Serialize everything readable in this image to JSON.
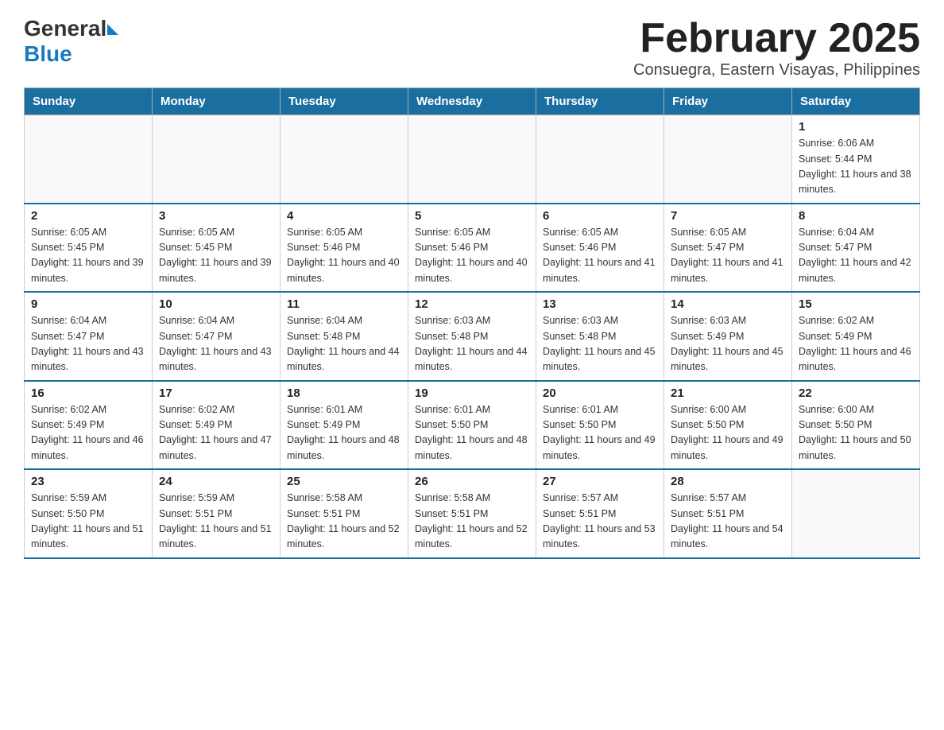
{
  "header": {
    "logo_general": "General",
    "logo_blue": "Blue",
    "month_title": "February 2025",
    "location": "Consuegra, Eastern Visayas, Philippines"
  },
  "weekdays": [
    "Sunday",
    "Monday",
    "Tuesday",
    "Wednesday",
    "Thursday",
    "Friday",
    "Saturday"
  ],
  "weeks": [
    [
      {
        "day": "",
        "info": ""
      },
      {
        "day": "",
        "info": ""
      },
      {
        "day": "",
        "info": ""
      },
      {
        "day": "",
        "info": ""
      },
      {
        "day": "",
        "info": ""
      },
      {
        "day": "",
        "info": ""
      },
      {
        "day": "1",
        "info": "Sunrise: 6:06 AM\nSunset: 5:44 PM\nDaylight: 11 hours and 38 minutes."
      }
    ],
    [
      {
        "day": "2",
        "info": "Sunrise: 6:05 AM\nSunset: 5:45 PM\nDaylight: 11 hours and 39 minutes."
      },
      {
        "day": "3",
        "info": "Sunrise: 6:05 AM\nSunset: 5:45 PM\nDaylight: 11 hours and 39 minutes."
      },
      {
        "day": "4",
        "info": "Sunrise: 6:05 AM\nSunset: 5:46 PM\nDaylight: 11 hours and 40 minutes."
      },
      {
        "day": "5",
        "info": "Sunrise: 6:05 AM\nSunset: 5:46 PM\nDaylight: 11 hours and 40 minutes."
      },
      {
        "day": "6",
        "info": "Sunrise: 6:05 AM\nSunset: 5:46 PM\nDaylight: 11 hours and 41 minutes."
      },
      {
        "day": "7",
        "info": "Sunrise: 6:05 AM\nSunset: 5:47 PM\nDaylight: 11 hours and 41 minutes."
      },
      {
        "day": "8",
        "info": "Sunrise: 6:04 AM\nSunset: 5:47 PM\nDaylight: 11 hours and 42 minutes."
      }
    ],
    [
      {
        "day": "9",
        "info": "Sunrise: 6:04 AM\nSunset: 5:47 PM\nDaylight: 11 hours and 43 minutes."
      },
      {
        "day": "10",
        "info": "Sunrise: 6:04 AM\nSunset: 5:47 PM\nDaylight: 11 hours and 43 minutes."
      },
      {
        "day": "11",
        "info": "Sunrise: 6:04 AM\nSunset: 5:48 PM\nDaylight: 11 hours and 44 minutes."
      },
      {
        "day": "12",
        "info": "Sunrise: 6:03 AM\nSunset: 5:48 PM\nDaylight: 11 hours and 44 minutes."
      },
      {
        "day": "13",
        "info": "Sunrise: 6:03 AM\nSunset: 5:48 PM\nDaylight: 11 hours and 45 minutes."
      },
      {
        "day": "14",
        "info": "Sunrise: 6:03 AM\nSunset: 5:49 PM\nDaylight: 11 hours and 45 minutes."
      },
      {
        "day": "15",
        "info": "Sunrise: 6:02 AM\nSunset: 5:49 PM\nDaylight: 11 hours and 46 minutes."
      }
    ],
    [
      {
        "day": "16",
        "info": "Sunrise: 6:02 AM\nSunset: 5:49 PM\nDaylight: 11 hours and 46 minutes."
      },
      {
        "day": "17",
        "info": "Sunrise: 6:02 AM\nSunset: 5:49 PM\nDaylight: 11 hours and 47 minutes."
      },
      {
        "day": "18",
        "info": "Sunrise: 6:01 AM\nSunset: 5:49 PM\nDaylight: 11 hours and 48 minutes."
      },
      {
        "day": "19",
        "info": "Sunrise: 6:01 AM\nSunset: 5:50 PM\nDaylight: 11 hours and 48 minutes."
      },
      {
        "day": "20",
        "info": "Sunrise: 6:01 AM\nSunset: 5:50 PM\nDaylight: 11 hours and 49 minutes."
      },
      {
        "day": "21",
        "info": "Sunrise: 6:00 AM\nSunset: 5:50 PM\nDaylight: 11 hours and 49 minutes."
      },
      {
        "day": "22",
        "info": "Sunrise: 6:00 AM\nSunset: 5:50 PM\nDaylight: 11 hours and 50 minutes."
      }
    ],
    [
      {
        "day": "23",
        "info": "Sunrise: 5:59 AM\nSunset: 5:50 PM\nDaylight: 11 hours and 51 minutes."
      },
      {
        "day": "24",
        "info": "Sunrise: 5:59 AM\nSunset: 5:51 PM\nDaylight: 11 hours and 51 minutes."
      },
      {
        "day": "25",
        "info": "Sunrise: 5:58 AM\nSunset: 5:51 PM\nDaylight: 11 hours and 52 minutes."
      },
      {
        "day": "26",
        "info": "Sunrise: 5:58 AM\nSunset: 5:51 PM\nDaylight: 11 hours and 52 minutes."
      },
      {
        "day": "27",
        "info": "Sunrise: 5:57 AM\nSunset: 5:51 PM\nDaylight: 11 hours and 53 minutes."
      },
      {
        "day": "28",
        "info": "Sunrise: 5:57 AM\nSunset: 5:51 PM\nDaylight: 11 hours and 54 minutes."
      },
      {
        "day": "",
        "info": ""
      }
    ]
  ]
}
